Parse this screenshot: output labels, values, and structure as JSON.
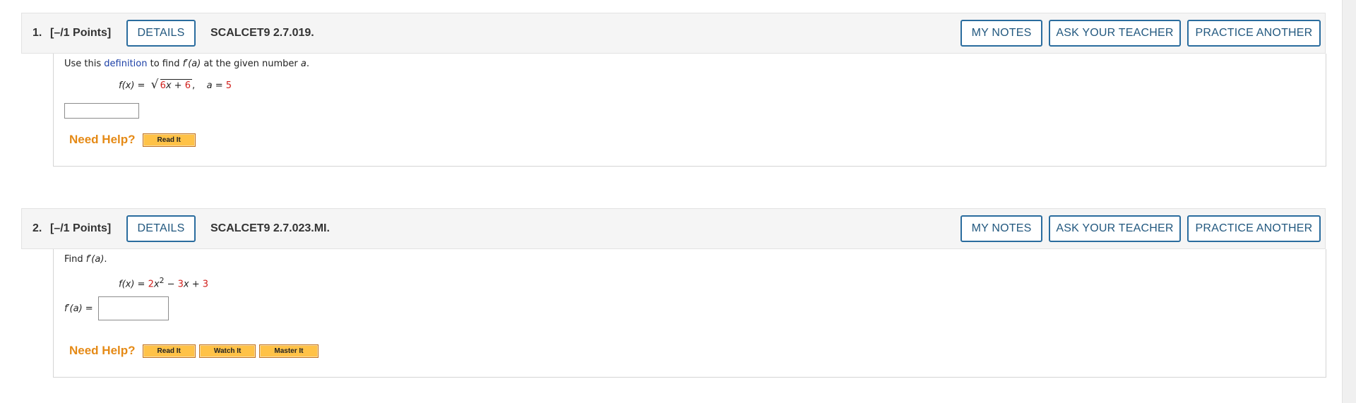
{
  "common": {
    "details_label": "DETAILS",
    "my_notes_label": "MY NOTES",
    "ask_teacher_label": "ASK YOUR TEACHER",
    "practice_another_label": "PRACTICE ANOTHER",
    "need_help_label": "Need Help?"
  },
  "questions": [
    {
      "number": "1.",
      "points": "[–/1 Points]",
      "code": "SCALCET9 2.7.019.",
      "prompt_before_link": "Use this ",
      "prompt_link": "definition",
      "prompt_after_link_1": " to find ",
      "prompt_fprime": "f′(a)",
      "prompt_after_link_2": " at the given number ",
      "prompt_var": "a",
      "prompt_end": ".",
      "formula": {
        "lhs": "f(x) = ",
        "radicand_coef": "6",
        "radicand_var": "x + ",
        "radicand_const": "6",
        "comma": ",",
        "a_label": "a = ",
        "a_value": "5"
      },
      "answer_value": "",
      "help_buttons": [
        "Read It"
      ]
    },
    {
      "number": "2.",
      "points": "[–/1 Points]",
      "code": "SCALCET9 2.7.023.MI.",
      "prompt_lead": "Find ",
      "prompt_fprime": "f′(a)",
      "prompt_end": ".",
      "formula": {
        "lhs": "f(x) = ",
        "c1": "2",
        "x1": "x",
        "exp": "2",
        "minus": " − ",
        "c2": "3",
        "x2": "x + ",
        "c3": "3"
      },
      "answer_label": "f′(a) = ",
      "answer_value": "",
      "help_buttons": [
        "Read It",
        "Watch It",
        "Master It"
      ]
    }
  ],
  "colors": {
    "button_border": "#2a6c9e",
    "button_text": "#22587f",
    "help_label": "#e58a16",
    "resource_button_bg": "#ffc247",
    "red_value": "#d0201c",
    "link": "#1b3fa6"
  }
}
